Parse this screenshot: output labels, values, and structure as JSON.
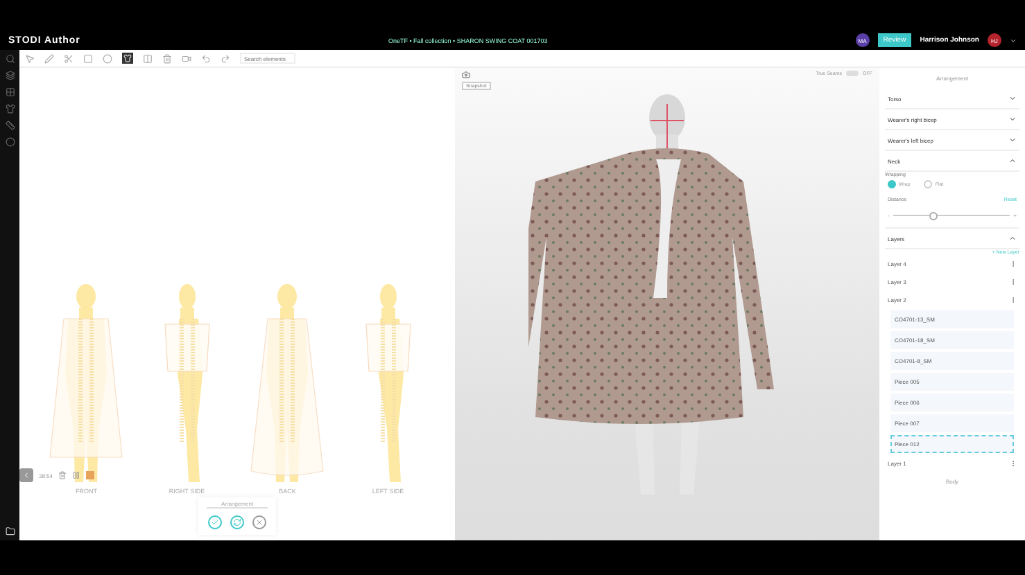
{
  "header": {
    "logo": "STODI Author",
    "breadcrumb": "OneTF • Fall collection • SHARON SWING COAT 001703",
    "badge": "MA",
    "review_button": "Review",
    "user_name": "Harrison Johnson",
    "user_initials": "HJ"
  },
  "toolbar": {
    "search_placeholder": "Search elements"
  },
  "views": [
    {
      "label": "FRONT"
    },
    {
      "label": "RIGHT SIDE"
    },
    {
      "label": "BACK"
    },
    {
      "label": "LEFT SIDE"
    }
  ],
  "playback": {
    "time": "38:54"
  },
  "arrangement_popup": {
    "title": "Arrangement"
  },
  "viewport": {
    "snapshot_label": "Snapshot",
    "true_seams": {
      "label": "True Seams",
      "value": "OFF",
      "on": false
    }
  },
  "panel": {
    "title": "Arrangement",
    "sections": [
      {
        "title": "Torso",
        "expanded": false
      },
      {
        "title": "Wearer's right bicep",
        "expanded": false
      },
      {
        "title": "Wearer's left bicep",
        "expanded": false
      },
      {
        "title": "Neck",
        "expanded": true
      }
    ],
    "wrapping": {
      "label": "Wrapping",
      "options": [
        {
          "label": "Wrap",
          "selected": true
        },
        {
          "label": "Flat",
          "selected": false
        }
      ]
    },
    "distance": {
      "label": "Distance",
      "reset": "Reset",
      "min_label": "-",
      "max_label": "+",
      "level": 0.33
    },
    "layers": {
      "title": "Layers",
      "expanded": true,
      "new_layer": "+ New Layer",
      "items": [
        {
          "name": "Layer 4"
        },
        {
          "name": "Layer 3"
        },
        {
          "name": "Layer 2",
          "children": [
            {
              "name": "CO4701-13_SM",
              "selected": false
            },
            {
              "name": "CO4701-18_SM",
              "selected": false
            },
            {
              "name": "CO4701-8_SM",
              "selected": false
            },
            {
              "name": "Piece 005",
              "selected": false
            },
            {
              "name": "Piece 006",
              "selected": false
            },
            {
              "name": "Piece 007",
              "selected": false
            },
            {
              "name": "Piece 012",
              "selected": true
            }
          ]
        },
        {
          "name": "Layer 1"
        }
      ],
      "body": "Body"
    }
  }
}
